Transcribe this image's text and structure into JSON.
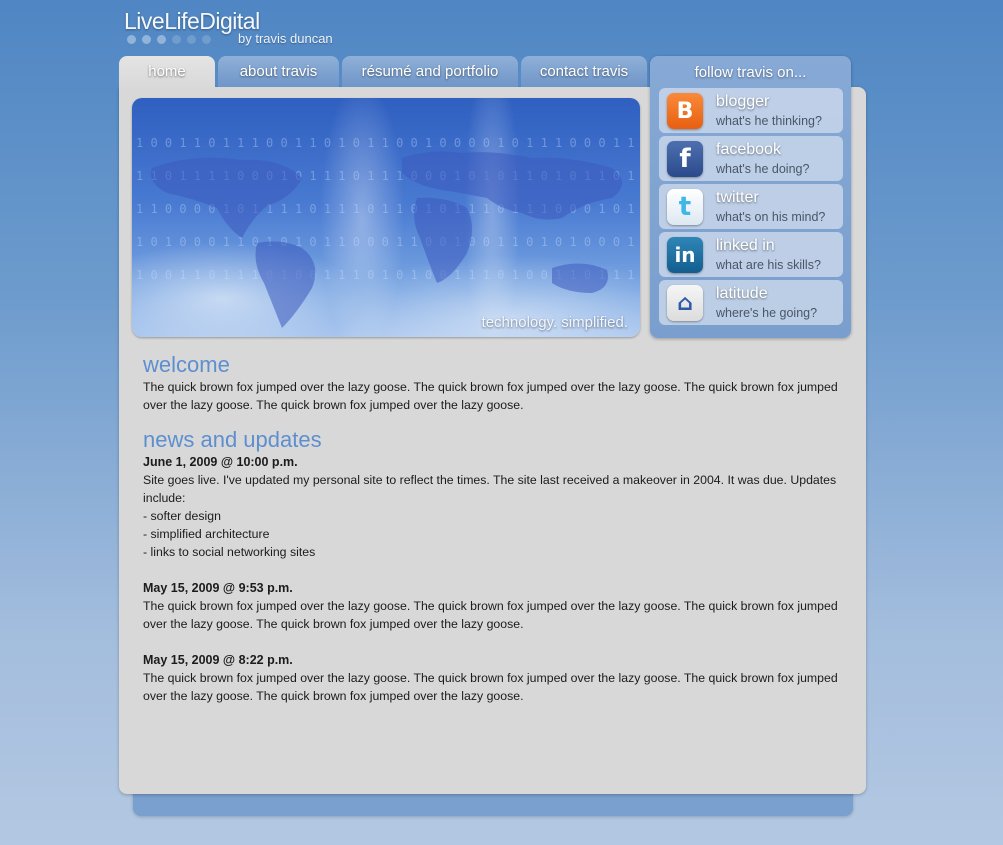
{
  "logo": {
    "title": "LiveLifeDigital",
    "subtitle": "by travis duncan"
  },
  "nav": {
    "tabs": [
      {
        "label": "home"
      },
      {
        "label": "about travis"
      },
      {
        "label": "résumé and portfolio"
      },
      {
        "label": "contact travis"
      }
    ]
  },
  "hero": {
    "tagline": "technology. simplified.",
    "binary_lines": [
      "1 0 0 1 1 0 1 1 1 0 0 1 1 0 1 0 1 1 0 0 1 0 0 0 0 1 0 1 1 1 0 0 0 1 1",
      "1 1 0 1 1 1 1 0 0 0 1 0 1 1 1 0 1 1 1 0 0 0 1 0 1 0 1 1 0 1 0 1 1 0 1 0",
      "1 1 0 0 0 0 1 0 1 1 1 1 0 1 1 1 0 1 1 0 1 0 1 1 1 0 1 1 1 0 0 0 1 0 1 0 0",
      "1 0 1 0 0 0 1 1 0 1 0 1 0 1 1 0 0 0 1 1 0 0 1 0 0 1 1 0 1 0 1 0 0 0 1 1 1",
      "1 0 0 1 1 0 1 1 1 0 1 0 0 1 1 1 0 1 0 1 0 0 1 1 1 0 1 0 0 1 1 0 1 1 1 0 1"
    ]
  },
  "follow": {
    "title": "follow travis on...",
    "items": [
      {
        "name": "blogger",
        "desc": "what's he thinking?",
        "glyph": "B"
      },
      {
        "name": "facebook",
        "desc": "what's he doing?",
        "glyph": "f"
      },
      {
        "name": "twitter",
        "desc": "what's on his mind?",
        "glyph": "t"
      },
      {
        "name": "linked in",
        "desc": "what are his skills?",
        "glyph": "in"
      },
      {
        "name": "latitude",
        "desc": "where's he going?",
        "glyph": "⌂"
      }
    ]
  },
  "welcome": {
    "heading": "welcome",
    "text": "The quick brown fox jumped over the lazy goose. The quick brown fox jumped over  the lazy goose. The quick brown fox jumped over the lazy goose. The quick brown fox jumped over the lazy goose."
  },
  "news": {
    "heading": "news and updates",
    "entries": [
      {
        "date": "June 1, 2009 @ 10:00 p.m.",
        "text": "Site goes live.  I've updated my personal site to reflect the times.  The site last received a makeover in 2004.  It was due.  Updates include:",
        "list": [
          "- softer design",
          "- simplified architecture",
          "- links to social networking sites"
        ]
      },
      {
        "date": "May 15, 2009 @ 9:53 p.m.",
        "text": "The quick brown fox jumped over the lazy goose. The quick brown fox jumped over  the lazy goose. The quick brown fox jumped over the lazy goose. The quick brown fox jumped over the lazy goose."
      },
      {
        "date": "May 15, 2009 @ 8:22 p.m.",
        "text": "The quick brown fox jumped over the lazy goose. The quick brown fox jumped over  the lazy goose. The quick brown fox jumped over the lazy goose. The quick brown fox jumped over the lazy goose."
      }
    ]
  }
}
